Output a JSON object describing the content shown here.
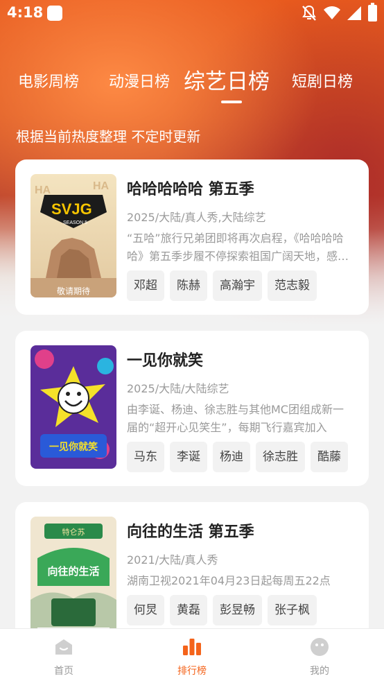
{
  "status_bar": {
    "time": "4:18"
  },
  "tabs": [
    {
      "label": "电影周榜",
      "active": false
    },
    {
      "label": "动漫日榜",
      "active": false
    },
    {
      "label": "综艺日榜",
      "active": true
    },
    {
      "label": "短剧日榜",
      "active": false
    }
  ],
  "subtitle": "根据当前热度整理 不定时更新",
  "cards": [
    {
      "title": "哈哈哈哈哈 第五季",
      "meta": "2025/大陆/真人秀,大陆综艺",
      "description": "“五哈”旅行兄弟团即将再次启程，《哈哈哈哈哈》第五季步履不停探索祖国广阔天地，感受人间烟火",
      "tags": [
        "邓超",
        "陈赫",
        "高瀚宇",
        "范志毅"
      ],
      "poster": {
        "text": "SVJG",
        "sub_text": "SEASON 5",
        "bottom_text": "敬请期待",
        "colors": [
          "#b88a5a",
          "#f0d8b0"
        ]
      }
    },
    {
      "title": "一见你就笑",
      "meta": "2025/大陆/大陆综艺",
      "description": "由李诞、杨迪、徐志胜与其他MC团组成新一届的“超开心见笑生”，每期飞行嘉宾加入",
      "tags": [
        "马东",
        "李诞",
        "杨迪",
        "徐志胜",
        "酷藤"
      ],
      "poster": {
        "text": "一见你就笑",
        "colors": [
          "#5a2d9a",
          "#f5e12a"
        ]
      }
    },
    {
      "title": "向往的生活 第五季",
      "meta": "2021/大陆/真人秀",
      "description": "湖南卫视2021年04月23日起每周五22点",
      "tags": [
        "何炅",
        "黄磊",
        "彭昱畅",
        "张子枫"
      ],
      "poster": {
        "text": "向往的生活",
        "badge": "特仑苏",
        "colors": [
          "#2a8a4a",
          "#f0e6d0"
        ]
      }
    }
  ],
  "bottom_nav": [
    {
      "label": "首页",
      "icon": "home-icon",
      "active": false
    },
    {
      "label": "排行榜",
      "icon": "ranking-icon",
      "active": true
    },
    {
      "label": "我的",
      "icon": "profile-icon",
      "active": false
    }
  ],
  "colors": {
    "accent": "#f4631a",
    "hero": "#e85a1e"
  }
}
